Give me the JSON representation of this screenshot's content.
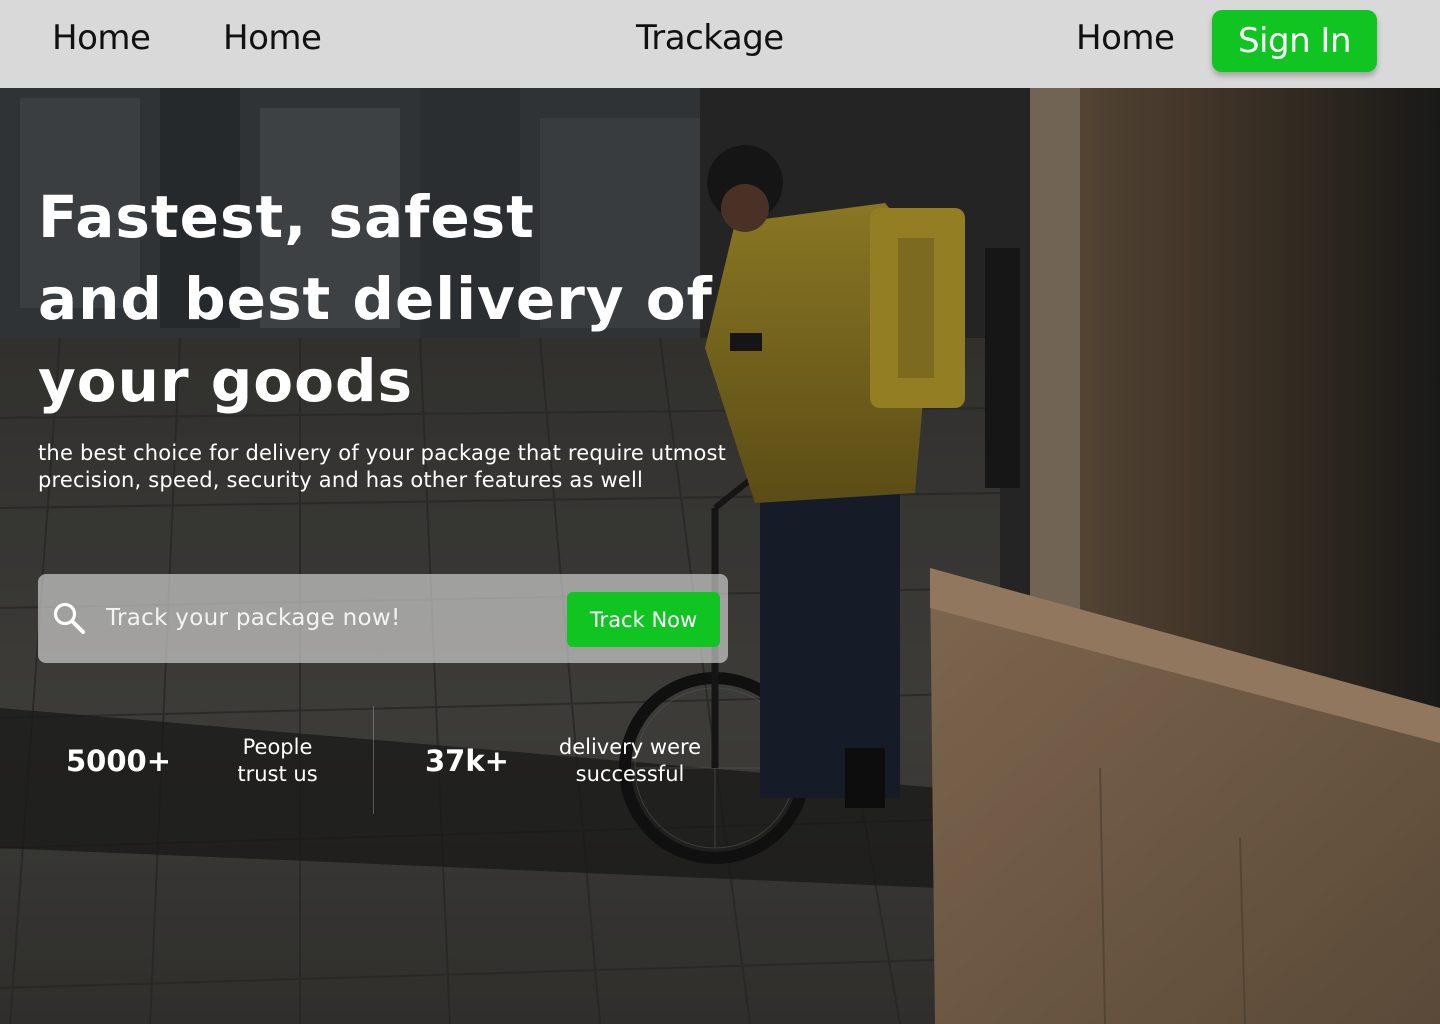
{
  "nav": {
    "link_1": "Home",
    "link_2": "Home",
    "brand": "Trackage",
    "link_3": "Home",
    "signin_label": "Sign In"
  },
  "hero": {
    "headline_lines": [
      "Fastest, safest",
      "and best delivery of",
      "your goods"
    ],
    "subtext_line_1": "the best choice for delivery of your package that require utmost",
    "subtext_line_2": "precision, speed, security and has other features as well"
  },
  "search": {
    "icon": "search-icon",
    "placeholder": "Track your package now!",
    "button_label": "Track Now"
  },
  "stats": [
    {
      "value": "5000+",
      "label_line_1": "People",
      "label_line_2": "trust us"
    },
    {
      "value": "37k+",
      "label_line_1": "delivery were",
      "label_line_2": "successful"
    }
  ],
  "colors": {
    "accent": "#10c522",
    "navbar_bg": "#d9d9d9",
    "text_on_dark": "#ffffff"
  }
}
